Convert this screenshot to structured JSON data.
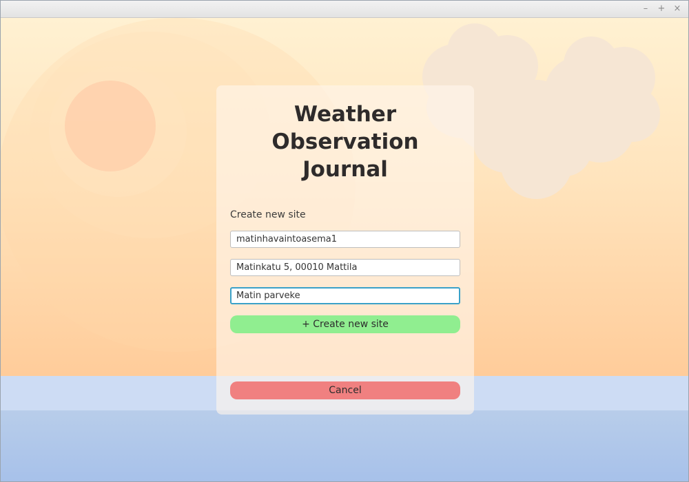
{
  "window": {
    "controls": {
      "minimize": "–",
      "maximize": "+",
      "close": "×"
    }
  },
  "app": {
    "title_line1": "Weather",
    "title_line2": "Observation",
    "title_line3": "Journal"
  },
  "form": {
    "section_label": "Create new site",
    "fields": [
      {
        "name": "site-name",
        "value": "matinhavaintoasema1"
      },
      {
        "name": "address",
        "value": "Matinkatu 5, 00010 Mattila"
      },
      {
        "name": "description",
        "value": "Matin parveke"
      }
    ],
    "create_label": "+ Create new site",
    "cancel_label": "Cancel"
  },
  "colors": {
    "create_button": "#90ee90",
    "cancel_button": "#f08080",
    "focus_border": "#3aa1c8"
  }
}
